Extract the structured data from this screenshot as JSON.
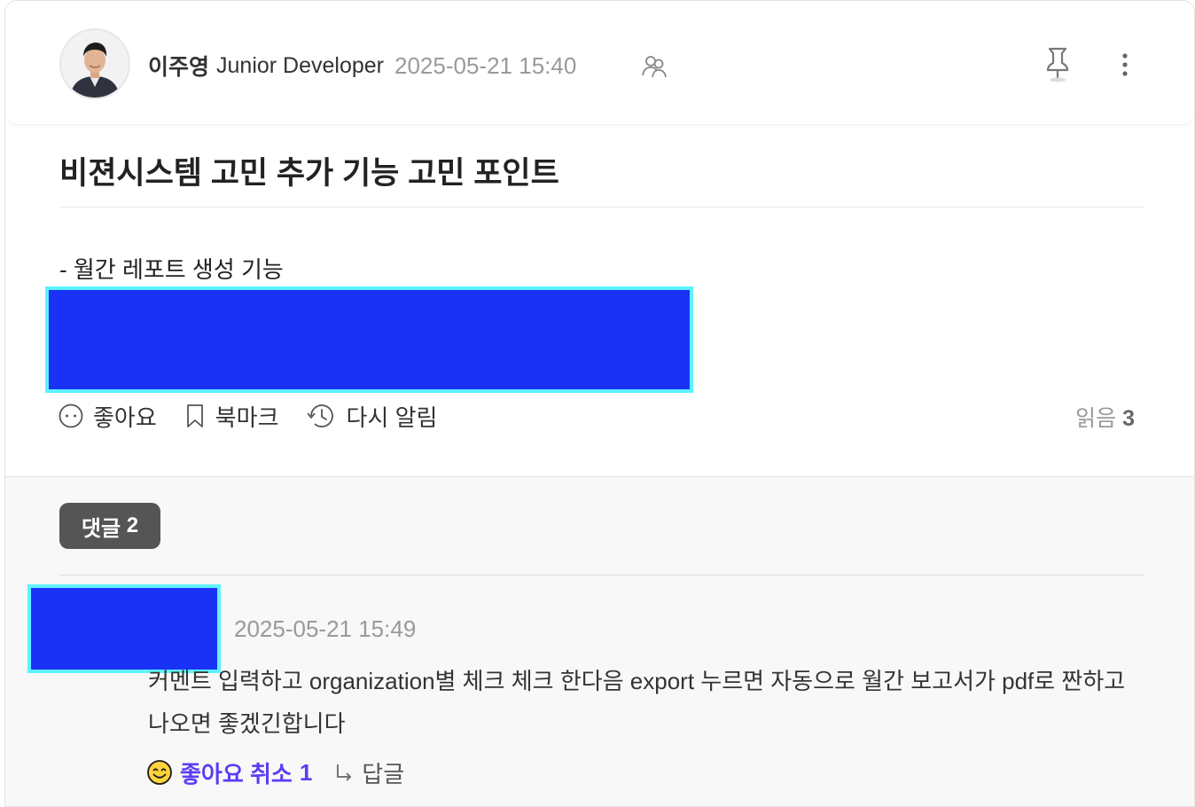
{
  "post": {
    "author_name": "이주영",
    "author_role": "Junior Developer",
    "date": "2025-05-21 15:40",
    "title": "비젼시스템 고민 추가 기능 고민 포인트",
    "body_line_1": "- 월간 레포트 생성 기능",
    "actions": {
      "like": "좋아요",
      "bookmark": "북마크",
      "remind": "다시 알림"
    },
    "read_label": "읽음",
    "read_count": "3"
  },
  "comments": {
    "badge_label": "댓글",
    "count": "2",
    "items": [
      {
        "date": "2025-05-21 15:49",
        "text": "커멘트 입력하고 organization별 체크 체크 한다음 export 누르면 자동으로 월간 보고서가 pdf로 짠하고 나오면 좋겠긴합니다",
        "like_cancel_label": "좋아요 취소",
        "like_count": "1",
        "reply_label": "답글"
      }
    ]
  },
  "colors": {
    "redaction_fill": "#1a32f5",
    "redaction_border": "#5cf3ff",
    "like_active": "#5b3df5",
    "badge_bg": "#555555"
  },
  "icons": [
    "people-icon",
    "pin-icon",
    "more-vertical-icon",
    "smile-icon",
    "bookmark-icon",
    "remind-icon",
    "emoji-smile-icon",
    "reply-arrow-icon"
  ]
}
